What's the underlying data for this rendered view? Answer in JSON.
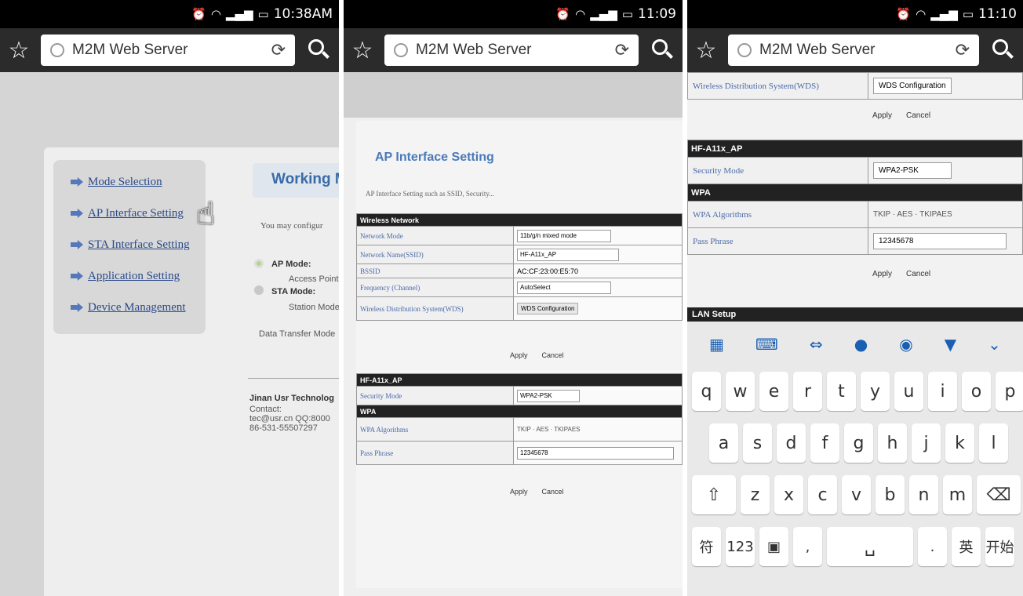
{
  "phones": [
    {
      "time": "10:38AM"
    },
    {
      "time": "11:09"
    },
    {
      "time": "11:10"
    }
  ],
  "browser": {
    "url_text": "M2M Web Server"
  },
  "screen1": {
    "menu": [
      "Mode Selection",
      "AP Interface Setting",
      "STA Interface Setting",
      "Application Setting",
      "Device Management"
    ],
    "working_mode_title": "Working M",
    "configure_text": "You may configur",
    "ap_mode": "AP Mode:",
    "access_point": "Access Point",
    "sta_mode": "STA Mode:",
    "station_mode": "Station Mode",
    "data_transfer": "Data Transfer Mode",
    "company": "Jinan Usr Technolog",
    "contact": "Contact:",
    "email": "tec@usr.cn QQ:8000",
    "phone": "86-531-55507297"
  },
  "screen2": {
    "title": "AP Interface Setting",
    "desc": "AP Interface Setting such as SSID, Security...",
    "wireless_header": "Wireless Network",
    "rows": [
      {
        "label": "Network Mode",
        "value": "11b/g/n mixed mode"
      },
      {
        "label": "Network Name(SSID)",
        "value": "HF-A11x_AP"
      },
      {
        "label": "BSSID",
        "value": "AC:CF:23:00:E5:70"
      },
      {
        "label": "Frequency (Channel)",
        "value": "AutoSelect"
      },
      {
        "label": "Wireless Distribution System(WDS)",
        "value": "WDS Configuration"
      }
    ],
    "apply": "Apply",
    "cancel": "Cancel",
    "ap_header": "HF-A11x_AP",
    "security_label": "Security Mode",
    "security_value": "WPA2-PSK",
    "wpa_header": "WPA",
    "wpa_alg_label": "WPA Algorithms",
    "alg_options": [
      "TKIP",
      "AES",
      "TKIPAES"
    ],
    "pass_label": "Pass Phrase",
    "pass_value": "12345678"
  },
  "screen3": {
    "wds_label": "Wireless Distribution System(WDS)",
    "wds_button": "WDS Configuration",
    "apply": "Apply",
    "cancel": "Cancel",
    "ap_header": "HF-A11x_AP",
    "security_label": "Security Mode",
    "security_value": "WPA2-PSK",
    "wpa_header": "WPA",
    "wpa_alg_label": "WPA Algorithms",
    "alg_options": [
      "TKIP",
      "AES",
      "TKIPAES"
    ],
    "pass_label": "Pass Phrase",
    "pass_value": "12345678",
    "lan_header": "LAN Setup"
  },
  "keyboard": {
    "row1": [
      "q",
      "w",
      "e",
      "r",
      "t",
      "y",
      "u",
      "i",
      "o",
      "p"
    ],
    "row2": [
      "a",
      "s",
      "d",
      "f",
      "g",
      "h",
      "j",
      "k",
      "l"
    ],
    "row3": [
      "z",
      "x",
      "c",
      "v",
      "b",
      "n",
      "m"
    ],
    "bottom": [
      "符",
      "123",
      ",",
      ".",
      "英",
      "开始"
    ]
  }
}
